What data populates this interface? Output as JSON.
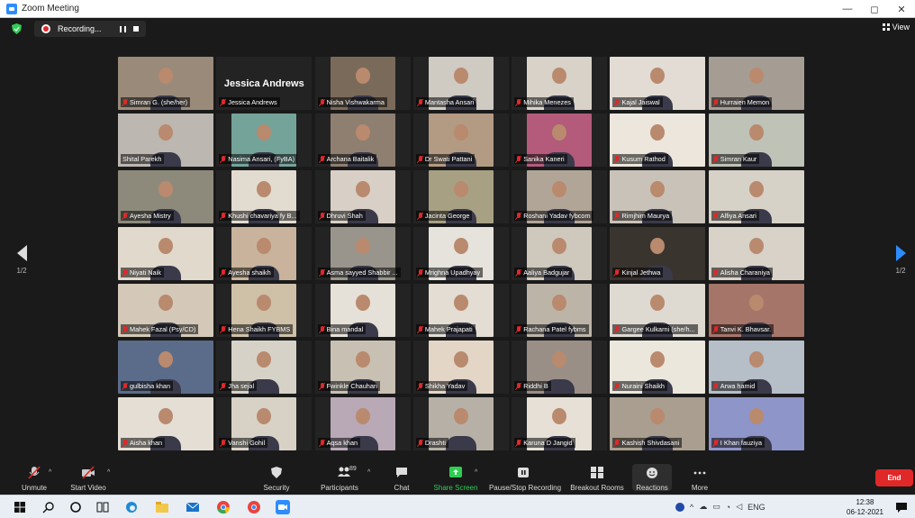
{
  "window": {
    "title": "Zoom Meeting",
    "controls": [
      "—",
      "◻",
      "✕"
    ]
  },
  "topbar": {
    "recording_label": "Recording...",
    "view_label": "View"
  },
  "pager": {
    "left": "1/2",
    "right": "1/2"
  },
  "participants": [
    {
      "name": "Simran G. (she/her)",
      "photo": "#9a8a7a"
    },
    {
      "name": "Jessica Andrews",
      "photo": "",
      "bigname": "Jessica Andrews"
    },
    {
      "name": "Nisha Vishwakarma",
      "photo": "#7a6a5a"
    },
    {
      "name": "Mantasha Ansari",
      "photo": "#cfcac2"
    },
    {
      "name": "Mihika Menezes",
      "photo": "#d8d2c9"
    },
    {
      "name": "Kajal Jaiswal",
      "photo": "#e2dcd4"
    },
    {
      "name": "Hurraien Memon",
      "photo": "#a59c94"
    },
    {
      "name": "Shital Parekh",
      "photo": "#bcb7b0",
      "active": true
    },
    {
      "name": "Nasima Ansari, (FyBA)",
      "photo": "#74a39a"
    },
    {
      "name": "Archana Baitalik",
      "photo": "#8f7f71"
    },
    {
      "name": "Dr Swati Pattani",
      "photo": "#b39a83"
    },
    {
      "name": "Sanika Kaneri",
      "photo": "#b45a7a"
    },
    {
      "name": "Kusum Rathod",
      "photo": "#ece6dc"
    },
    {
      "name": "Simran Kaur",
      "photo": "#bfc2b6"
    },
    {
      "name": "Ayesha Mistry",
      "photo": "#8d8a7c"
    },
    {
      "name": "Khushi chavariya fy B...",
      "photo": "#e2dbd0"
    },
    {
      "name": "Dhruvi Shah",
      "photo": "#d8d0c6"
    },
    {
      "name": "Jacinta George",
      "photo": "#a7a082"
    },
    {
      "name": "Roshani Yadav fybcom",
      "photo": "#b1a598"
    },
    {
      "name": "Rimjhim Maurya",
      "photo": "#c9c2b8"
    },
    {
      "name": "Alfiya Ansari",
      "photo": "#d7d2c7"
    },
    {
      "name": "Niyati Naik",
      "photo": "#e1d9cc"
    },
    {
      "name": "Ayesha  shaikh",
      "photo": "#c9b39c"
    },
    {
      "name": "Asma sayyed Shabbir ...",
      "photo": "#9a958c"
    },
    {
      "name": "Mrighna Upadhyay",
      "photo": "#e6e3dc"
    },
    {
      "name": "Aaliya Badgujar",
      "photo": "#cfc8bd"
    },
    {
      "name": "Kinjal Jethwa",
      "photo": "#3a342f"
    },
    {
      "name": "Alisha Charaniya",
      "photo": "#d8d2c9"
    },
    {
      "name": "Mahek Fazal (Psy/CD)",
      "photo": "#d4c9b8"
    },
    {
      "name": "Hena Shaikh FYBMS",
      "photo": "#cfc0a8"
    },
    {
      "name": "Bina mandal",
      "photo": "#e6e1d8"
    },
    {
      "name": "Mahek Prajapati",
      "photo": "#e3ddd3"
    },
    {
      "name": "Rachana Patel fybms",
      "photo": "#bdb4a8"
    },
    {
      "name": "Gargee Kulkarni (she/h...",
      "photo": "#dedad2"
    },
    {
      "name": "Tanvi K. Bhavsar.",
      "photo": "#a6756a"
    },
    {
      "name": "gulbisha khan",
      "photo": "#5b6c8a"
    },
    {
      "name": "Jha sejal",
      "photo": "#d7d2c8"
    },
    {
      "name": "Fwinkle Chauhan",
      "photo": "#c8c0b2"
    },
    {
      "name": "Shikha Yadav",
      "photo": "#e4d6c6"
    },
    {
      "name": "Riddhi B",
      "photo": "#9a8f86"
    },
    {
      "name": "Nuraini Shaikh",
      "photo": "#ece7dd"
    },
    {
      "name": "Arwa hamid",
      "photo": "#b6bec8"
    },
    {
      "name": "Aisha khan",
      "photo": "#e4ded5"
    },
    {
      "name": "Vanshi Gohil",
      "photo": "#d8d2c6"
    },
    {
      "name": "Aqsa khan",
      "photo": "#b9a8b6"
    },
    {
      "name": "Drashti",
      "photo": "#b7b0a6"
    },
    {
      "name": "Karuna D Jangid",
      "photo": "#e6e0d7"
    },
    {
      "name": "Kashish Shivdasani",
      "photo": "#a99e8f"
    },
    {
      "name": "I Khan fauziya",
      "photo": "#8e95c8"
    }
  ],
  "toolbar": {
    "unmute": "Unmute",
    "start_video": "Start Video",
    "security": "Security",
    "participants": "Participants",
    "participants_count": "89",
    "chat": "Chat",
    "share_screen": "Share Screen",
    "pause_recording": "Pause/Stop Recording",
    "breakout_rooms": "Breakout Rooms",
    "reactions": "Reactions",
    "more": "More",
    "end": "End"
  },
  "taskbar": {
    "lang": "ENG",
    "time": "12:38",
    "date": "06-12-2021"
  },
  "colors": {
    "accent": "#2d8cff",
    "end_red": "#e02828",
    "share_green": "#2dcf53",
    "active_speaker": "#c8d94a"
  }
}
